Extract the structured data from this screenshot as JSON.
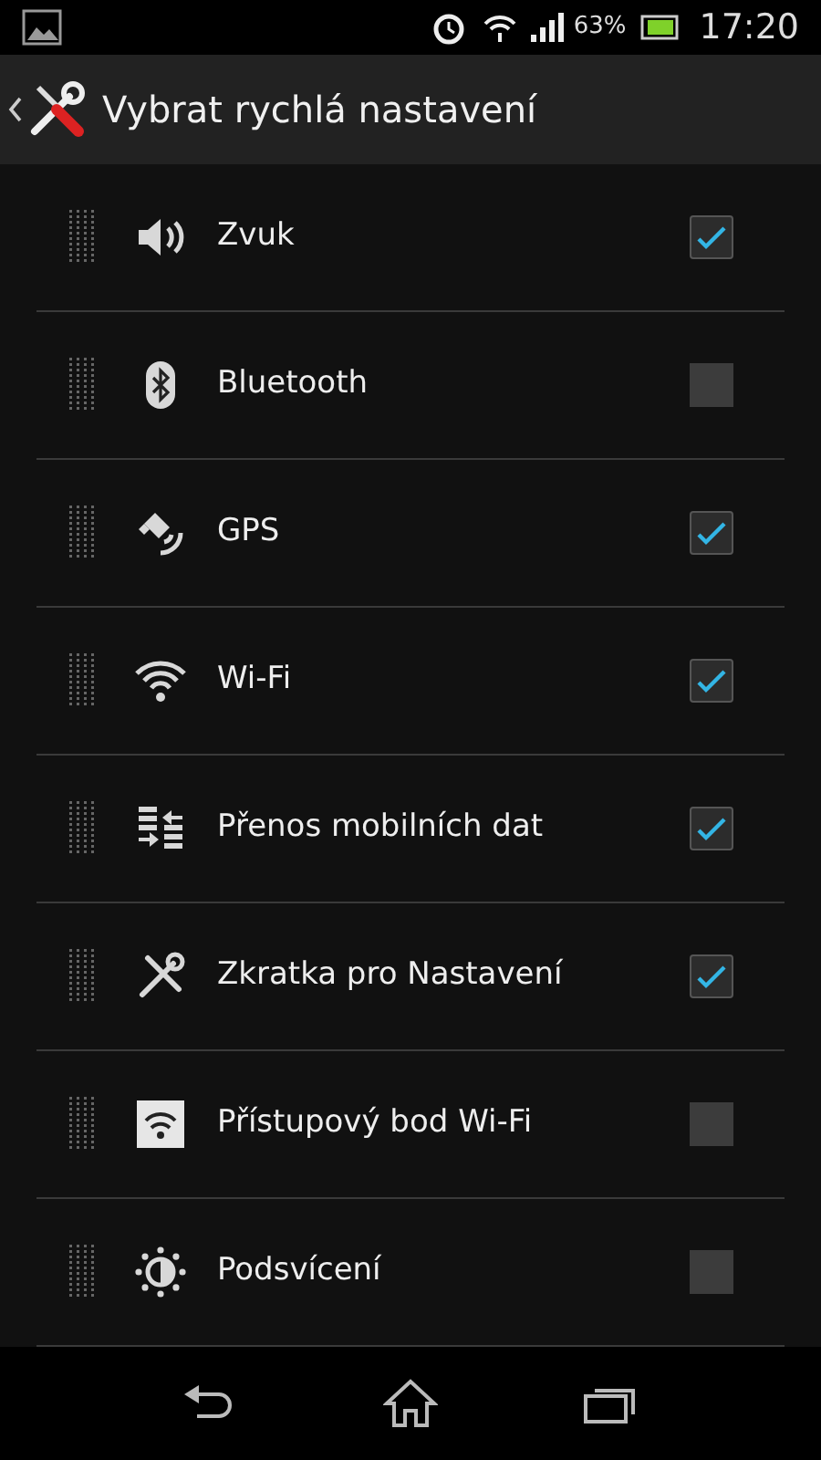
{
  "status_bar": {
    "battery": "63%",
    "time": "17:20"
  },
  "action_bar": {
    "title": "Vybrat rychlá nastavení"
  },
  "items": [
    {
      "label": "Zvuk",
      "checked": true
    },
    {
      "label": "Bluetooth",
      "checked": false
    },
    {
      "label": "GPS",
      "checked": true
    },
    {
      "label": "Wi-Fi",
      "checked": true
    },
    {
      "label": "Přenos mobilních dat",
      "checked": true
    },
    {
      "label": "Zkratka pro Nastavení",
      "checked": true
    },
    {
      "label": "Přístupový bod Wi-Fi",
      "checked": false
    },
    {
      "label": "Podsvícení",
      "checked": false
    }
  ]
}
